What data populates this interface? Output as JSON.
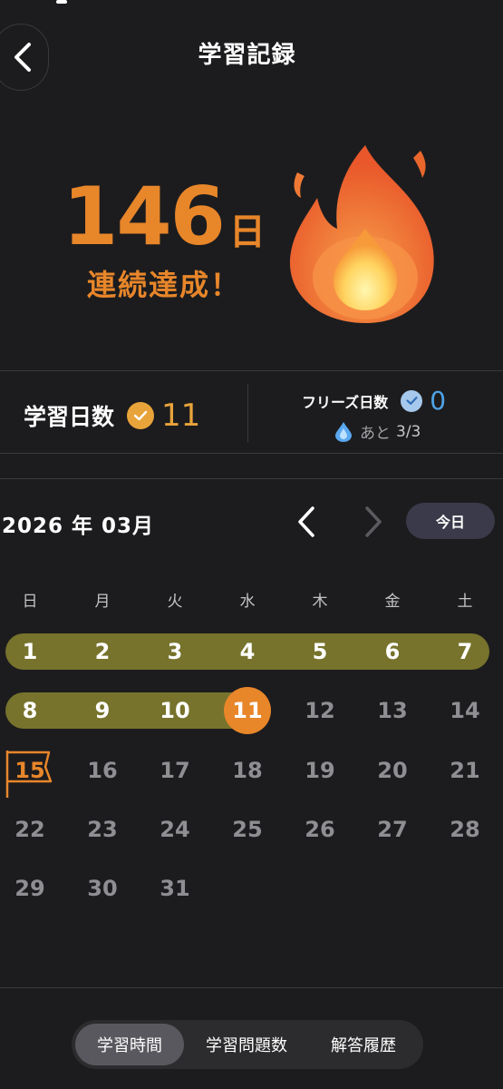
{
  "header": {
    "title": "学習記録",
    "back_icon": "chevron-left-icon"
  },
  "streak": {
    "count": "146",
    "unit": "日",
    "message": "連続達成！",
    "icon": "fire-icon"
  },
  "stats": {
    "study_days_label": "学習日数",
    "study_days_value": "11",
    "freeze_days_label": "フリーズ日数",
    "freeze_days_value": "0",
    "remaining_label": "あと",
    "remaining_value": "3/3"
  },
  "calendar": {
    "month_label": "2026 年 03月",
    "today_label": "今日",
    "weekdays": [
      "日",
      "月",
      "火",
      "水",
      "木",
      "金",
      "土"
    ],
    "days": [
      {
        "n": "1",
        "status": "done"
      },
      {
        "n": "2",
        "status": "done"
      },
      {
        "n": "3",
        "status": "done"
      },
      {
        "n": "4",
        "status": "done"
      },
      {
        "n": "5",
        "status": "done"
      },
      {
        "n": "6",
        "status": "done"
      },
      {
        "n": "7",
        "status": "done"
      },
      {
        "n": "8",
        "status": "done"
      },
      {
        "n": "9",
        "status": "done"
      },
      {
        "n": "10",
        "status": "done"
      },
      {
        "n": "11",
        "status": "today"
      },
      {
        "n": "12",
        "status": "future"
      },
      {
        "n": "13",
        "status": "future"
      },
      {
        "n": "14",
        "status": "future"
      },
      {
        "n": "15",
        "status": "goal"
      },
      {
        "n": "16",
        "status": "future"
      },
      {
        "n": "17",
        "status": "future"
      },
      {
        "n": "18",
        "status": "future"
      },
      {
        "n": "19",
        "status": "future"
      },
      {
        "n": "20",
        "status": "future"
      },
      {
        "n": "21",
        "status": "future"
      },
      {
        "n": "22",
        "status": "future"
      },
      {
        "n": "23",
        "status": "future"
      },
      {
        "n": "24",
        "status": "future"
      },
      {
        "n": "25",
        "status": "future"
      },
      {
        "n": "26",
        "status": "future"
      },
      {
        "n": "27",
        "status": "future"
      },
      {
        "n": "28",
        "status": "future"
      },
      {
        "n": "29",
        "status": "future"
      },
      {
        "n": "30",
        "status": "future"
      },
      {
        "n": "31",
        "status": "future"
      }
    ]
  },
  "tabs": [
    {
      "label": "学習時間",
      "active": true
    },
    {
      "label": "学習問題数",
      "active": false
    },
    {
      "label": "解答履歴",
      "active": false
    }
  ],
  "colors": {
    "accent": "#e8862a",
    "streak_bar": "#77732c",
    "freeze": "#4fa3e6",
    "background": "#1c1c1e"
  }
}
